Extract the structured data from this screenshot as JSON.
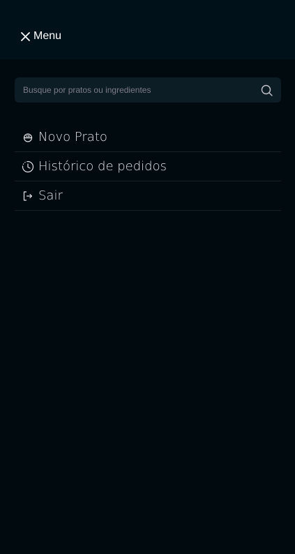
{
  "header": {
    "close_icon": "close-icon",
    "title": "Menu"
  },
  "search": {
    "placeholder": "Busque por pratos ou ingredientes",
    "icon": "search-icon"
  },
  "menu": {
    "items": [
      {
        "label": "Novo Prato",
        "icon": "dish-icon"
      },
      {
        "label": "Histórico de pedidos",
        "icon": "clock-icon"
      },
      {
        "label": "Sair",
        "icon": "sign-out-icon"
      }
    ]
  },
  "colors": {
    "background": "#000A0F",
    "header": "#00111A",
    "input": "#0D1D25",
    "divider": "#192227",
    "text": "#E1E1E6",
    "placeholder": "#7C7C8A"
  }
}
